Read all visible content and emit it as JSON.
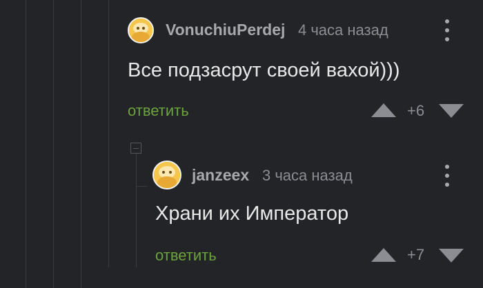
{
  "comments": [
    {
      "username": "VonuchiuPerdej",
      "time": "4 часа назад",
      "text": "Все подзасрут своей вахой)))",
      "reply_label": "ответить",
      "rating": "+6"
    },
    {
      "username": "janzeex",
      "time": "3 часа назад",
      "text": "Храни их Император",
      "reply_label": "ответить",
      "rating": "+7"
    }
  ],
  "colors": {
    "background": "#232427",
    "reply_link": "#6ca33d",
    "username": "#a7a9ad",
    "secondary": "#8b8d92",
    "text": "#e8e8e9",
    "avatar": "#f6c64c"
  },
  "icons": {
    "more": "vertical-ellipsis-icon",
    "upvote": "triangle-up-icon",
    "downvote": "triangle-down-icon",
    "collapse": "minus-square-icon"
  }
}
